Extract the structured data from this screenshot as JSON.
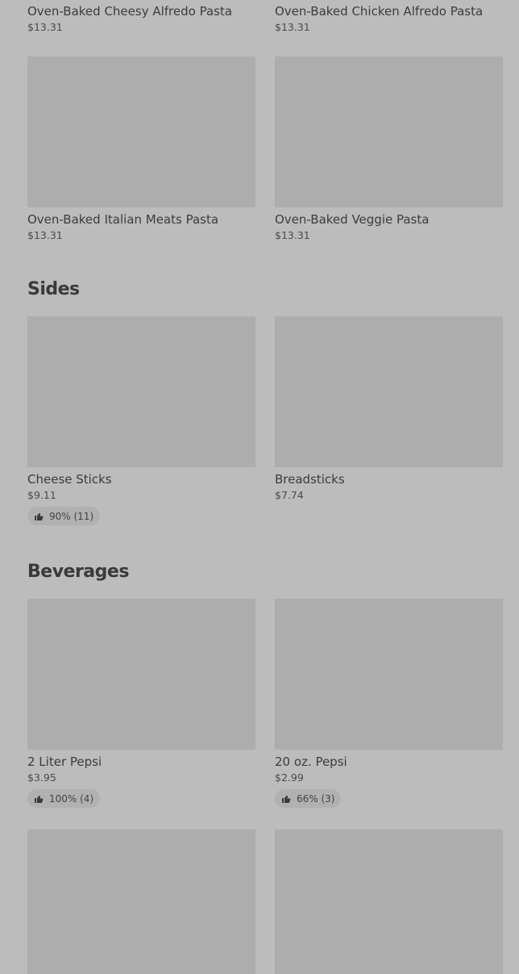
{
  "pasta": {
    "items": [
      {
        "name": "Oven-Baked Cheesy Alfredo Pasta",
        "price": "$13.31"
      },
      {
        "name": "Oven-Baked Chicken Alfredo Pasta",
        "price": "$13.31"
      },
      {
        "name": "Oven-Baked Italian Meats Pasta",
        "price": "$13.31"
      },
      {
        "name": "Oven-Baked Veggie Pasta",
        "price": "$13.31"
      }
    ]
  },
  "sides": {
    "title": "Sides",
    "items": [
      {
        "name": "Cheese Sticks",
        "price": "$9.11",
        "rating": "90% (11)"
      },
      {
        "name": "Breadsticks",
        "price": "$7.74"
      }
    ]
  },
  "beverages": {
    "title": "Beverages",
    "items": [
      {
        "name": "2 Liter Pepsi",
        "price": "$3.95",
        "rating": "100% (4)"
      },
      {
        "name": "20 oz. Pepsi",
        "price": "$2.99",
        "rating": "66% (3)"
      }
    ]
  },
  "icons": {
    "rating": "thumbs-up-icon"
  },
  "colors": {
    "background": "#bcbcbc",
    "image_placeholder": "#adadad",
    "rating_pill": "#b1b1b1"
  }
}
